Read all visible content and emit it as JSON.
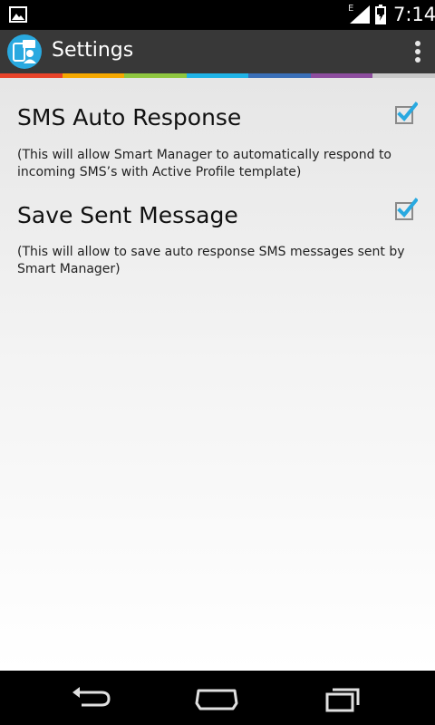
{
  "status_bar": {
    "network_type": "E",
    "clock": "7:14",
    "icons": [
      "gallery-icon",
      "signal-icon",
      "battery-icon"
    ]
  },
  "action_bar": {
    "title": "Settings",
    "icons": [
      "app-icon",
      "overflow-menu-icon"
    ]
  },
  "accent_colors": [
    "#e8432a",
    "#f5a800",
    "#8ec63f",
    "#1fb3e6",
    "#3a6fb7",
    "#8d4d9e",
    "#c8c8c8"
  ],
  "preferences": [
    {
      "title": "SMS Auto Response",
      "summary": "(This will allow Smart Manager to automatically respond to incoming SMS’s with Active Profile template)",
      "checked": true
    },
    {
      "title": "Save Sent Message",
      "summary": "(This will allow to save auto response SMS messages sent by Smart Manager)",
      "checked": true
    }
  ],
  "navigation": {
    "buttons": [
      "back-icon",
      "home-icon",
      "recent-apps-icon"
    ]
  }
}
